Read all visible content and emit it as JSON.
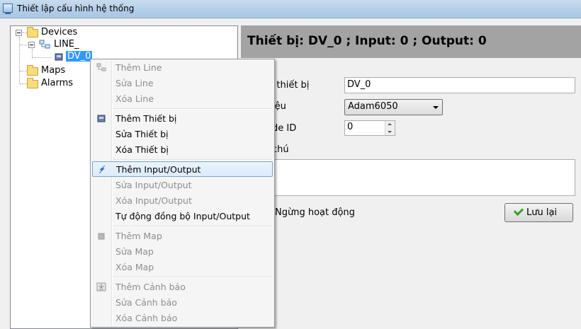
{
  "window": {
    "title": "Thiết lập cấu hình hệ thống"
  },
  "tree": {
    "root": "Devices",
    "line": "LINE_",
    "device": "DV_0",
    "maps": "Maps",
    "alarms": "Alarms"
  },
  "header": {
    "title": "Thiết bị: DV_0 ; Input: 0 ; Output: 0"
  },
  "form": {
    "name_label": "n thiết bị",
    "name_value": "DV_0",
    "model_label": "iệu",
    "model_value": "Adam6050",
    "node_label": "de ID",
    "node_value": "0",
    "note_label": "chú",
    "stop_label": "Ngừng hoạt động",
    "save_label": "Lưu lại"
  },
  "menu": {
    "items": [
      {
        "label": "Thêm Line",
        "enabled": false
      },
      {
        "label": "Sửa Line",
        "enabled": false
      },
      {
        "label": "Xóa Line",
        "enabled": false
      },
      {
        "label": "Thêm Thiết bị",
        "enabled": true
      },
      {
        "label": "Sửa Thiết bị",
        "enabled": true
      },
      {
        "label": "Xóa Thiết bị",
        "enabled": true
      },
      {
        "label": "Thêm Input/Output",
        "enabled": true,
        "highlighted": true
      },
      {
        "label": "Sửa Input/Output",
        "enabled": false
      },
      {
        "label": "Xóa Input/Output",
        "enabled": false
      },
      {
        "label": "Tự động đồng bộ Input/Output",
        "enabled": true
      },
      {
        "label": "Thêm Map",
        "enabled": false
      },
      {
        "label": "Sửa Map",
        "enabled": false
      },
      {
        "label": "Xóa Map",
        "enabled": false
      },
      {
        "label": "Thêm Cảnh báo",
        "enabled": false
      },
      {
        "label": "Sửa Cảnh báo",
        "enabled": false
      },
      {
        "label": "Xóa Cảnh báo",
        "enabled": false
      }
    ]
  },
  "colors": {
    "selection": "#3399ff",
    "header_bg": "#a3a3a3",
    "menu_highlight_border": "#7da2ce"
  }
}
